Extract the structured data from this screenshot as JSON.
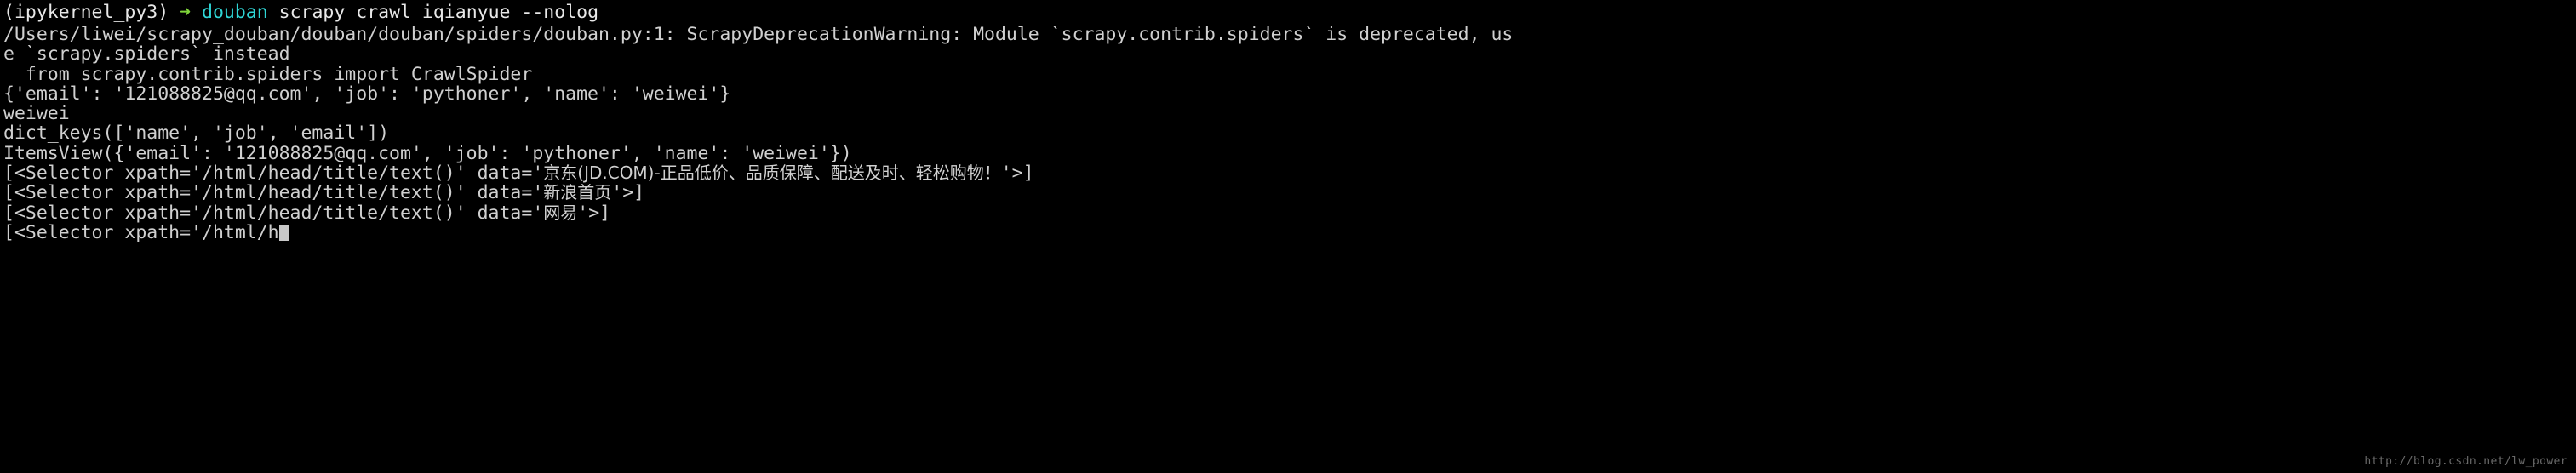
{
  "terminal": {
    "background_color": "#000000",
    "foreground_color": "#d8d8d8",
    "prompt": {
      "env": "(ipykernel_py3)",
      "arrow": "➜",
      "arrow_color": "#7fd43a",
      "dir": "douban",
      "dir_color": "#2fd6d6",
      "command": " scrapy crawl iqianyue --nolog"
    },
    "lines": [
      "/Users/liwei/scrapy_douban/douban/douban/spiders/douban.py:1: ScrapyDeprecationWarning: Module `scrapy.contrib.spiders` is deprecated, us",
      "e `scrapy.spiders` instead",
      "  from scrapy.contrib.spiders import CrawlSpider",
      "{'email': '121088825@qq.com', 'job': 'pythoner', 'name': 'weiwei'}",
      "weiwei",
      "dict_keys(['name', 'job', 'email'])",
      "ItemsView({'email': '121088825@qq.com', 'job': 'pythoner', 'name': 'weiwei'})"
    ],
    "selector_lines": [
      {
        "prefix": "[<Selector xpath='/html/head/title/text()' data='",
        "cjk": "京东(JD.COM)-正品低价、品质保障、配送及时、轻松购物！",
        "suffix": "'>]"
      },
      {
        "prefix": "[<Selector xpath='/html/head/title/text()' data='",
        "cjk": "新浪首页",
        "suffix": "'>]"
      },
      {
        "prefix": "[<Selector xpath='/html/head/title/text()' data='",
        "cjk": "网易",
        "suffix": "'>]"
      }
    ],
    "last_partial_line": "[<Selector xpath='/html/h",
    "watermark": "http://blog.csdn.net/lw_power"
  }
}
